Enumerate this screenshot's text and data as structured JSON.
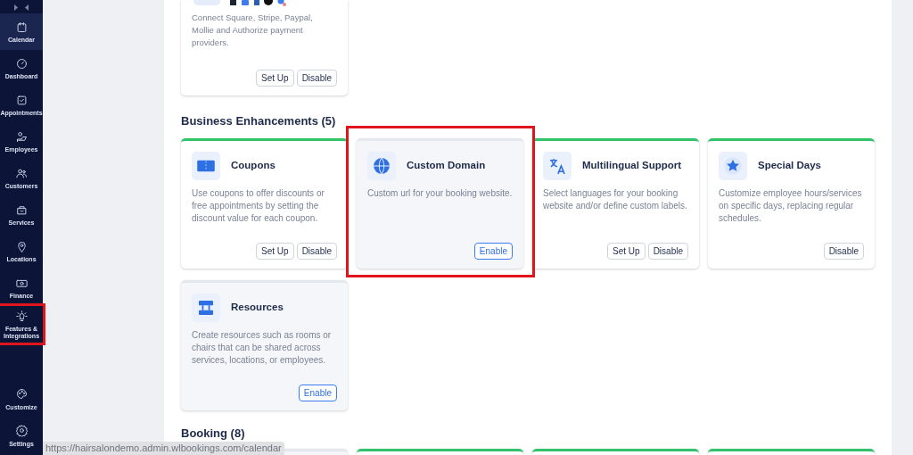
{
  "sidebar": {
    "items": [
      {
        "label": "Calendar",
        "selected": true,
        "highlighted": false
      },
      {
        "label": "Dashboard",
        "selected": false,
        "highlighted": false
      },
      {
        "label": "Appointments",
        "selected": false,
        "highlighted": false
      },
      {
        "label": "Employees",
        "selected": false,
        "highlighted": false
      },
      {
        "label": "Customers",
        "selected": false,
        "highlighted": false
      },
      {
        "label": "Services",
        "selected": false,
        "highlighted": false
      },
      {
        "label": "Locations",
        "selected": false,
        "highlighted": false
      },
      {
        "label": "Finance",
        "selected": false,
        "highlighted": false
      },
      {
        "label": "Features & Integrations",
        "selected": false,
        "highlighted": true
      }
    ],
    "bottom_items": [
      {
        "label": "Customize"
      },
      {
        "label": "Settings"
      }
    ]
  },
  "top_card": {
    "description": "Connect Square, Stripe, Paypal, Mollie and Authorize payment providers.",
    "enabled": true,
    "buttons": [
      "Set Up",
      "Disable"
    ]
  },
  "sections": [
    {
      "title": "Business Enhancements (5)",
      "cards": [
        {
          "title": "Coupons",
          "description": "Use coupons to offer discounts or free appointments by setting the discount value for each coupon.",
          "enabled": true,
          "highlighted": false,
          "buttons": [
            "Set Up",
            "Disable"
          ]
        },
        {
          "title": "Custom Domain",
          "description": "Custom url for your booking website.",
          "enabled": false,
          "highlighted": true,
          "buttons": [
            "Enable"
          ]
        },
        {
          "title": "Multilingual Support",
          "description": "Select languages for your booking website and/or define custom labels.",
          "enabled": true,
          "highlighted": false,
          "buttons": [
            "Set Up",
            "Disable"
          ]
        },
        {
          "title": "Special Days",
          "description": "Customize employee hours/services on specific days, replacing regular schedules.",
          "enabled": true,
          "highlighted": false,
          "buttons": [
            "Disable"
          ]
        },
        {
          "title": "Resources",
          "description": "Create resources such as rooms or chairs that can be shared across services, locations, or employees.",
          "enabled": false,
          "highlighted": false,
          "buttons": [
            "Enable"
          ]
        }
      ]
    },
    {
      "title": "Booking (8)",
      "cards": [
        {
          "enabled": false
        },
        {
          "enabled": true
        },
        {
          "enabled": true
        },
        {
          "enabled": true
        }
      ]
    }
  ],
  "status_url": "https://hairsalondemo.admin.wlbookings.com/calendar"
}
